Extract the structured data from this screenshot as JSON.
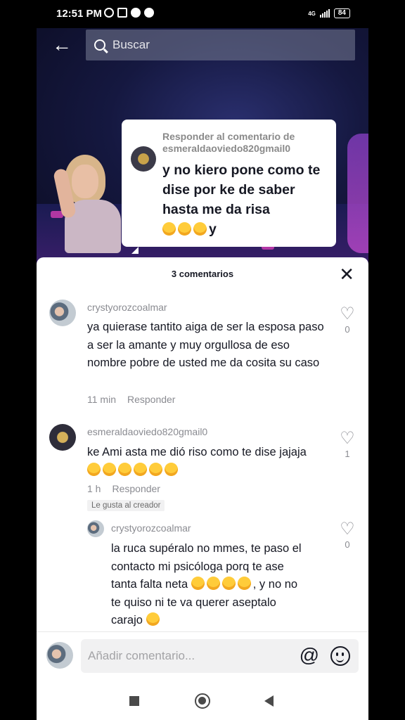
{
  "status_bar": {
    "time": "12:51 PM",
    "network": "4G",
    "battery": "84"
  },
  "search": {
    "placeholder": "Buscar"
  },
  "reply_bubble": {
    "header_line1": "Responder al comentario de",
    "header_line2": "esmeraldaoviedo820gmail0",
    "text": "y no kiero pone como te dise por ke de saber hasta me da risa",
    "trailing_text": "y"
  },
  "comments_panel": {
    "title": "3 comentarios",
    "comments": [
      {
        "user": "crystyorozcoalmar",
        "text": "ya quierase tantito aiga de ser la esposa paso a ser la amante y muy orgullosa de eso nombre pobre de usted me da cosita su caso",
        "time": "11 min",
        "reply_label": "Responder",
        "likes": "0"
      },
      {
        "user": "esmeraldaoviedo820gmail0",
        "text": "ke Ami asta me dió riso como te dise jajaja",
        "time": "1 h",
        "reply_label": "Responder",
        "likes": "1",
        "badge": "Le gusta al creador"
      },
      {
        "user": "crystyorozcoalmar",
        "text_line1": "la ruca supéralo no mmes, te paso el",
        "text_line2": "contacto mi psicóloga porq te ase",
        "text_line3": "tanta falta neta",
        "text_line3b": ", y no no",
        "text_line4": "te quiso ni te va querer aseptalo",
        "text_line5": "carajo",
        "likes": "0"
      }
    ]
  },
  "input_bar": {
    "placeholder": "Añadir comentario...",
    "at_symbol": "@"
  },
  "icons": {
    "back": "arrow-left-icon",
    "search": "search-icon",
    "close": "close-icon",
    "heart": "heart-icon",
    "emoji": "smile-icon"
  }
}
